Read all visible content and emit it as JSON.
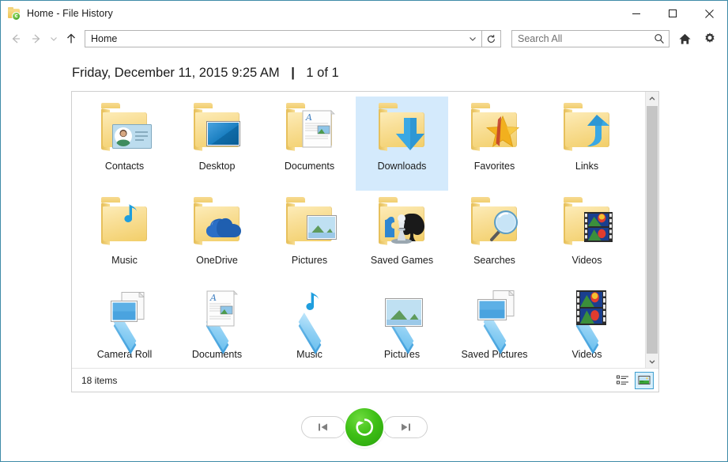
{
  "window": {
    "title": "Home - File History",
    "icon": "file-history-folder-icon",
    "border_color": "#3f8ba8",
    "controls": {
      "minimize": "Minimize",
      "maximize": "Maximize",
      "close": "Close"
    }
  },
  "toolbar": {
    "back": "Back",
    "forward": "Forward",
    "recent": "Recent locations",
    "up": "Up",
    "address_value": "Home",
    "address_dropdown": "Previous locations",
    "refresh": "Refresh",
    "search_placeholder": "Search All",
    "search_value": "",
    "home_button": "Home",
    "settings_button": "Settings"
  },
  "header": {
    "date": "Friday, December 11, 2015 9:25 AM",
    "separator": "|",
    "position": "1 of 1"
  },
  "content": {
    "selection_color": "#d4eafc",
    "rows": [
      [
        {
          "label": "Contacts",
          "icon": "folder-contacts-icon",
          "type": "folder",
          "selected": false
        },
        {
          "label": "Desktop",
          "icon": "folder-desktop-icon",
          "type": "folder",
          "selected": false
        },
        {
          "label": "Documents",
          "icon": "folder-documents-icon",
          "type": "folder",
          "selected": false
        },
        {
          "label": "Downloads",
          "icon": "folder-downloads-icon",
          "type": "folder",
          "selected": true
        },
        {
          "label": "Favorites",
          "icon": "folder-favorites-icon",
          "type": "folder",
          "selected": false
        },
        {
          "label": "Links",
          "icon": "folder-links-icon",
          "type": "folder",
          "selected": false
        }
      ],
      [
        {
          "label": "Music",
          "icon": "folder-music-icon",
          "type": "folder",
          "selected": false
        },
        {
          "label": "OneDrive",
          "icon": "folder-onedrive-icon",
          "type": "folder",
          "selected": false
        },
        {
          "label": "Pictures",
          "icon": "folder-pictures-icon",
          "type": "folder",
          "selected": false
        },
        {
          "label": "Saved Games",
          "icon": "folder-saved-games-icon",
          "type": "folder",
          "selected": false
        },
        {
          "label": "Searches",
          "icon": "folder-searches-icon",
          "type": "folder",
          "selected": false
        },
        {
          "label": "Videos",
          "icon": "folder-videos-icon",
          "type": "folder",
          "selected": false
        }
      ],
      [
        {
          "label": "Camera Roll",
          "icon": "library-camera-roll-icon",
          "type": "library",
          "selected": false
        },
        {
          "label": "Documents",
          "icon": "library-documents-icon",
          "type": "library",
          "selected": false
        },
        {
          "label": "Music",
          "icon": "library-music-icon",
          "type": "library",
          "selected": false
        },
        {
          "label": "Pictures",
          "icon": "library-pictures-icon",
          "type": "library",
          "selected": false
        },
        {
          "label": "Saved Pictures",
          "icon": "library-saved-pictures-icon",
          "type": "library",
          "selected": false
        },
        {
          "label": "Videos",
          "icon": "library-videos-icon",
          "type": "library",
          "selected": false
        }
      ]
    ]
  },
  "statusbar": {
    "item_count": "18 items",
    "view_details": "Details view",
    "view_large_icons": "Large icons view",
    "active_view": "large-icons"
  },
  "restore_controls": {
    "previous": "Previous version",
    "restore": "Restore to original location",
    "next": "Next version",
    "restore_color": "#3fc016"
  }
}
